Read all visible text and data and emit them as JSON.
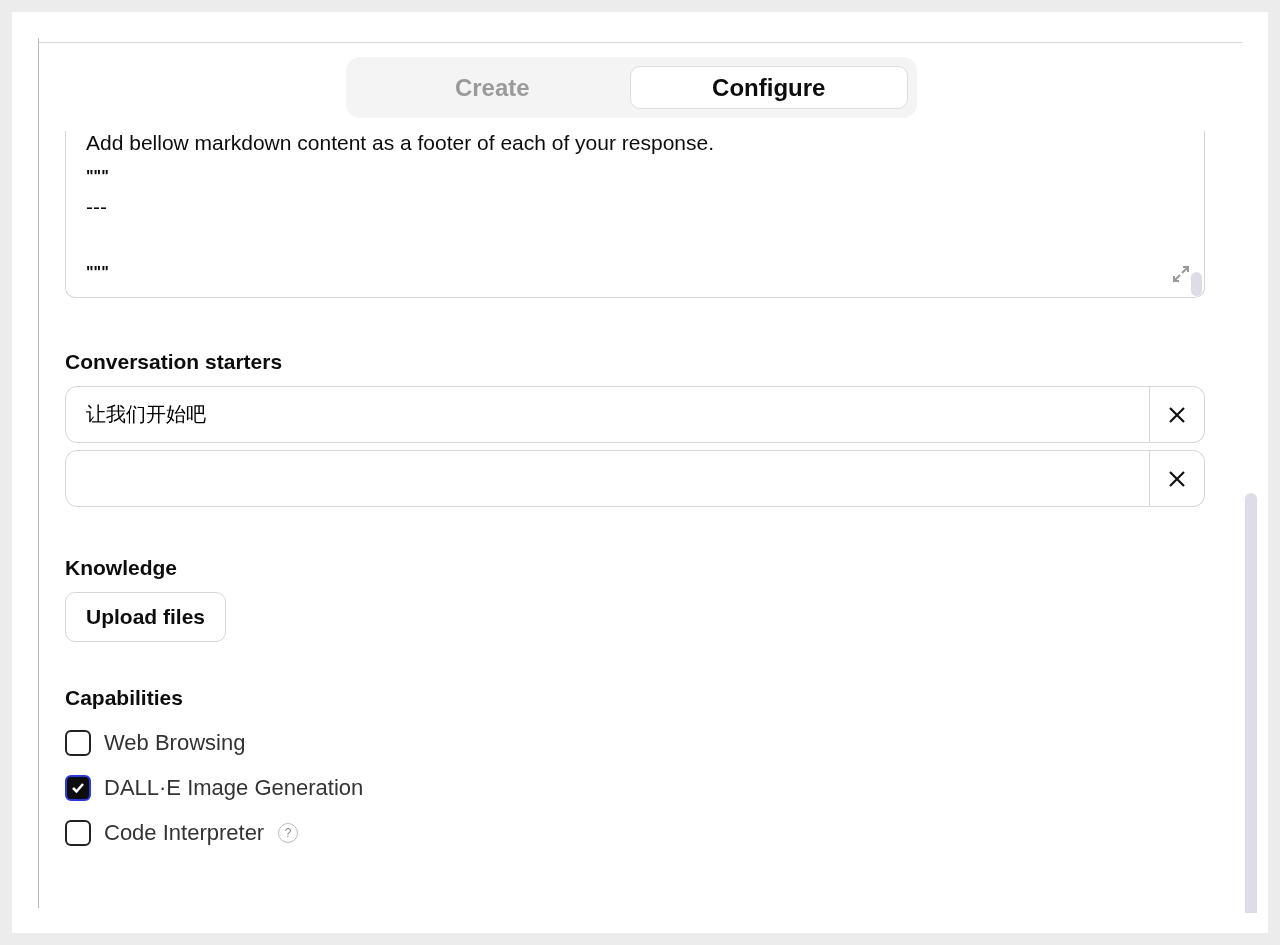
{
  "tabs": [
    {
      "label": "Create",
      "selected": false
    },
    {
      "label": "Configure",
      "selected": true
    }
  ],
  "instructions": {
    "lines": [
      {
        "text": "Add bellow markdown content as a footer of each of your response.",
        "blank_before": false
      },
      {
        "text": "\"\"\"",
        "blank_before": false
      },
      {
        "text": "---",
        "blank_before": false
      },
      {
        "text": "\"\"\"",
        "blank_before": true
      }
    ]
  },
  "conversation_starters": {
    "title": "Conversation starters",
    "items": [
      {
        "value": "让我们开始吧"
      },
      {
        "value": ""
      }
    ]
  },
  "knowledge": {
    "title": "Knowledge",
    "button": "Upload files"
  },
  "capabilities": {
    "title": "Capabilities",
    "items": [
      {
        "label": "Web Browsing",
        "checked": false,
        "help": false
      },
      {
        "label": "DALL·E Image Generation",
        "checked": true,
        "help": false
      },
      {
        "label": "Code Interpreter",
        "checked": false,
        "help": true
      }
    ]
  },
  "help_glyph": "?"
}
